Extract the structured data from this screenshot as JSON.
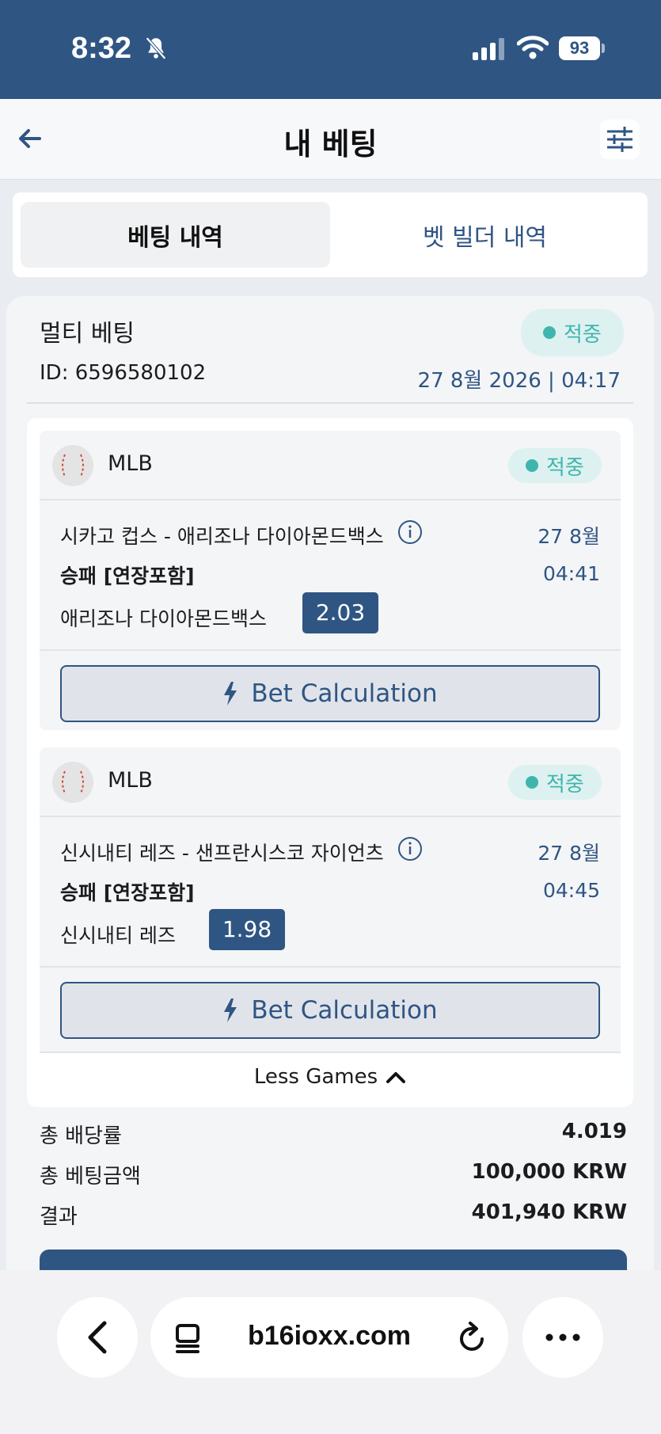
{
  "status_bar": {
    "time": "8:32",
    "battery": "93"
  },
  "header": {
    "title": "내 베팅"
  },
  "tabs": [
    {
      "label": "베팅 내역"
    },
    {
      "label": "벳 빌더 내역"
    }
  ],
  "bet": {
    "type": "멀티 베팅",
    "id": "ID: 6596580102",
    "status": "적중",
    "datetime": "27 8월 2026 | 04:17",
    "games": [
      {
        "league": "MLB",
        "status": "적중",
        "match": "시카고 컵스 - 애리조나 다이아몬드백스",
        "date": "27 8월",
        "market": "승패 [연장포함]",
        "time": "04:41",
        "selection": "애리조나 다이아몬드백스",
        "odds": "2.03",
        "calc_label": "Bet Calculation"
      },
      {
        "league": "MLB",
        "status": "적중",
        "match": "신시내티 레즈 - 샌프란시스코 자이언츠",
        "date": "27 8월",
        "market": "승패 [연장포함]",
        "time": "04:45",
        "selection": "신시내티 레즈",
        "odds": "1.98",
        "calc_label": "Bet Calculation"
      }
    ],
    "less_games_label": "Less Games",
    "summary": {
      "total_odds_label": "총 배당률",
      "total_odds": "4.019",
      "total_stake_label": "총 베팅금액",
      "total_stake": "100,000 KRW",
      "result_label": "결과",
      "result": "401,940 KRW"
    }
  },
  "browser": {
    "url": "b16ioxx.com"
  },
  "colors": {
    "brand": "#2f5583",
    "win": "#3fb5ad",
    "win_bg": "#ddf1f0"
  }
}
